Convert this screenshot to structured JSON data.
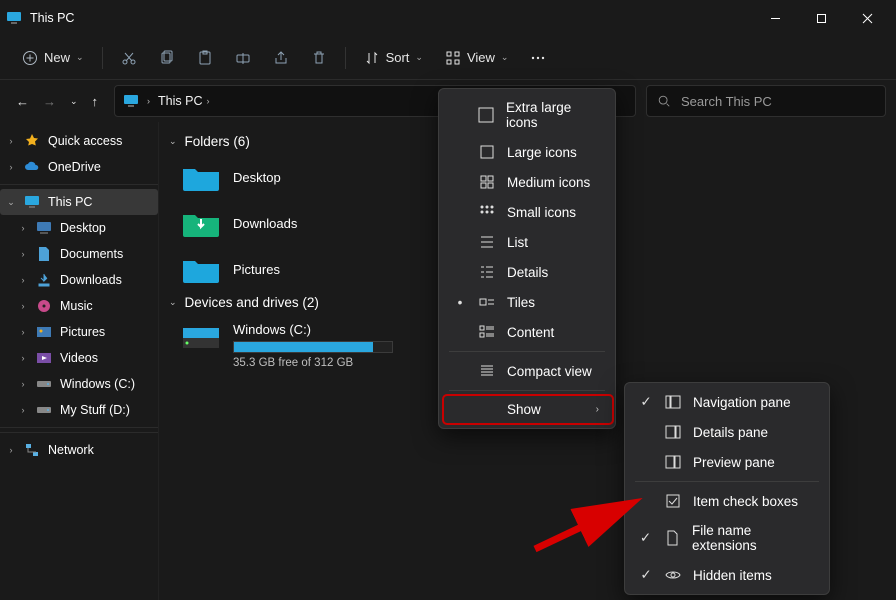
{
  "title": "This PC",
  "toolbar": {
    "new": "New",
    "sort": "Sort",
    "view": "View"
  },
  "addressbar": {
    "crumb1": "This PC",
    "crumb_sep": "›"
  },
  "search": {
    "placeholder": "Search This PC"
  },
  "sidebar": [
    {
      "label": "Quick access",
      "icon": "star",
      "chev": "›"
    },
    {
      "label": "OneDrive",
      "icon": "cloud",
      "chev": "›"
    },
    {
      "label": "This PC",
      "icon": "pc",
      "chev": "⌄",
      "active": true
    },
    {
      "label": "Desktop",
      "icon": "desktop",
      "chev": "›",
      "indent": true
    },
    {
      "label": "Documents",
      "icon": "documents",
      "chev": "›",
      "indent": true
    },
    {
      "label": "Downloads",
      "icon": "downloads",
      "chev": "›",
      "indent": true
    },
    {
      "label": "Music",
      "icon": "music",
      "chev": "›",
      "indent": true
    },
    {
      "label": "Pictures",
      "icon": "pictures",
      "chev": "›",
      "indent": true
    },
    {
      "label": "Videos",
      "icon": "videos",
      "chev": "›",
      "indent": true
    },
    {
      "label": "Windows (C:)",
      "icon": "drive",
      "chev": "›",
      "indent": true
    },
    {
      "label": "My Stuff (D:)",
      "icon": "drive",
      "chev": "›",
      "indent": true
    },
    {
      "label": "Network",
      "icon": "network",
      "chev": "›"
    }
  ],
  "groups": {
    "folders": {
      "label": "Folders (6)",
      "items": [
        "Desktop",
        "Downloads",
        "Pictures"
      ]
    },
    "drives": {
      "label": "Devices and drives (2)",
      "items": [
        {
          "name": "Windows (C:)",
          "sub": "35.3 GB free of 312 GB",
          "fill_pct": 88
        }
      ]
    }
  },
  "viewmenu": {
    "items": [
      "Extra large icons",
      "Large icons",
      "Medium icons",
      "Small icons",
      "List",
      "Details",
      "Tiles",
      "Content"
    ],
    "selected_index": 6,
    "compact": "Compact view",
    "show": "Show"
  },
  "showmenu": {
    "items": [
      {
        "label": "Navigation pane",
        "checked": true,
        "icon": "nav"
      },
      {
        "label": "Details pane",
        "checked": false,
        "icon": "details"
      },
      {
        "label": "Preview pane",
        "checked": false,
        "icon": "preview"
      },
      {
        "label": "Item check boxes",
        "checked": false,
        "icon": "checkbox",
        "divider_before": true
      },
      {
        "label": "File name extensions",
        "checked": true,
        "icon": "file"
      },
      {
        "label": "Hidden items",
        "checked": true,
        "icon": "eye"
      }
    ]
  }
}
